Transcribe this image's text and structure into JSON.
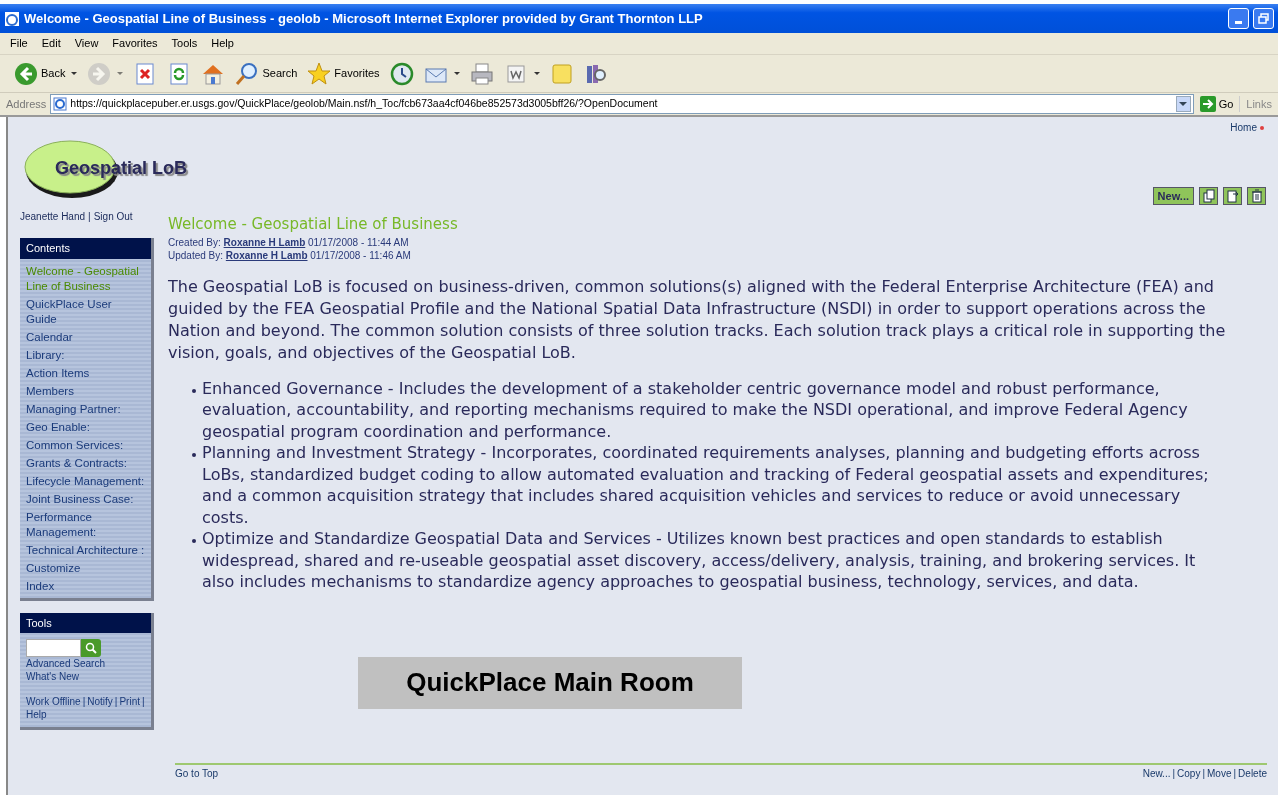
{
  "window": {
    "title": "Welcome - Geospatial Line of Business - geolob - Microsoft Internet Explorer provided by Grant Thornton LLP"
  },
  "menu": [
    "File",
    "Edit",
    "View",
    "Favorites",
    "Tools",
    "Help"
  ],
  "toolbar": [
    {
      "kind": "back",
      "label": "Back",
      "dropdown": true,
      "disabled": false
    },
    {
      "kind": "forward",
      "dropdown": true,
      "disabled": true
    },
    {
      "kind": "stop",
      "dropdown": false,
      "disabled": false
    },
    {
      "kind": "refresh",
      "dropdown": false,
      "disabled": false
    },
    {
      "kind": "home",
      "dropdown": false,
      "disabled": false
    },
    {
      "kind": "search",
      "label": "Search",
      "dropdown": false,
      "disabled": false
    },
    {
      "kind": "favorites",
      "label": "Favorites",
      "dropdown": false,
      "disabled": false
    },
    {
      "kind": "history",
      "dropdown": false,
      "disabled": false
    },
    {
      "kind": "mail",
      "dropdown": true,
      "disabled": false
    },
    {
      "kind": "print",
      "dropdown": false,
      "disabled": false
    },
    {
      "kind": "edit",
      "dropdown": true,
      "disabled": false
    },
    {
      "kind": "notes",
      "dropdown": false,
      "disabled": false
    },
    {
      "kind": "research",
      "dropdown": false,
      "disabled": false
    }
  ],
  "address_bar": {
    "label": "Address",
    "url": "https://quickplacepuber.er.usgs.gov/QuickPlace/geolob/Main.nsf/h_Toc/fcb673aa4cf046be852573d3005bff26/?OpenDocument",
    "go": "Go",
    "links": "Links"
  },
  "page": {
    "home_link": "Home",
    "logo": "Geospatial LoB",
    "user_links": [
      "Jeanette Hand",
      "Sign Out"
    ],
    "separator": "|",
    "action_buttons": [
      {
        "kind": "text",
        "label": "New..."
      },
      {
        "kind": "copy"
      },
      {
        "kind": "move"
      },
      {
        "kind": "delete"
      }
    ],
    "contents": {
      "title": "Contents",
      "items": [
        {
          "label": "Welcome - Geospatial Line of Business",
          "selected": true
        },
        {
          "label": "QuickPlace User Guide",
          "selected": false
        },
        {
          "label": "Calendar",
          "selected": false
        },
        {
          "label": "Library:",
          "selected": false
        },
        {
          "label": "Action Items",
          "selected": false
        },
        {
          "label": "Members",
          "selected": false
        },
        {
          "label": "Managing Partner:",
          "selected": false
        },
        {
          "label": "Geo Enable:",
          "selected": false
        },
        {
          "label": "Common Services:",
          "selected": false
        },
        {
          "label": "Grants & Contracts:",
          "selected": false
        },
        {
          "label": "Lifecycle Management:",
          "selected": false
        },
        {
          "label": "Joint Business Case:",
          "selected": false
        },
        {
          "label": "Performance Management:",
          "selected": false
        },
        {
          "label": "Technical Architecture :",
          "selected": false
        },
        {
          "label": "Customize",
          "selected": false
        },
        {
          "label": "Index",
          "selected": false
        }
      ]
    },
    "tools": {
      "title": "Tools",
      "links": [
        "Advanced Search",
        "What's New"
      ],
      "footer_links": [
        "Work Offline",
        "Notify",
        "Print",
        "Help"
      ]
    },
    "article": {
      "title": "Welcome - Geospatial Line of Business",
      "meta": [
        {
          "label": "Created By:",
          "author": "Roxanne H Lamb",
          "date": "01/17/2008 - 11:44 AM"
        },
        {
          "label": "Updated By:",
          "author": "Roxanne H Lamb",
          "date": "01/17/2008 - 11:46 AM"
        }
      ],
      "intro": "The Geospatial LoB is focused on business-driven, common solutions(s) aligned with the Federal Enterprise Architecture (FEA) and guided by the FEA Geospatial Profile and the National Spatial Data Infrastructure (NSDI) in order to support operations across the Nation and beyond. The common solution consists of three solution tracks. Each solution track plays a critical role in supporting the vision, goals, and objectives of the Geospatial LoB.",
      "bullets": [
        "Enhanced Governance - Includes the development of a stakeholder centric governance model and robust performance, evaluation, accountability, and reporting mechanisms required to make the NSDI operational, and improve Federal Agency geospatial program coordination and performance.",
        "Planning and Investment Strategy - Incorporates, coordinated requirements analyses, planning and budgeting efforts across LoBs, standardized budget coding to allow automated evaluation and tracking of Federal geospatial assets and expenditures; and a common acquisition strategy that includes shared acquisition vehicles and services to reduce or avoid unnecessary costs.",
        "Optimize and Standardize Geospatial Data and Services - Utilizes known best practices and open standards to establish widespread, shared and re-useable geospatial asset discovery, access/delivery, analysis, training, and brokering services. It also includes mechanisms to standardize agency approaches to geospatial business, technology, services, and data."
      ]
    },
    "banner": "QuickPlace Main Room",
    "footer": {
      "top_link": "Go to Top",
      "links": [
        "New...",
        "Copy",
        "Move",
        "Delete"
      ]
    }
  }
}
